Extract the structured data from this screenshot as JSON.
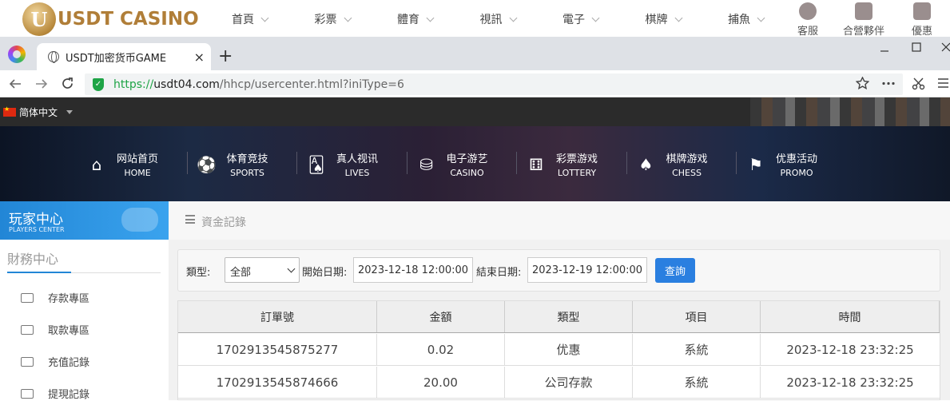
{
  "casino": {
    "logo_text": "USDT CASINO",
    "logo_letter": "U",
    "nav": [
      "首頁",
      "彩票",
      "體育",
      "視訊",
      "電子",
      "棋牌",
      "捕魚"
    ],
    "icons": [
      {
        "label": "客服",
        "icon": "chat-icon"
      },
      {
        "label": "合營夥伴",
        "icon": "partners-icon"
      },
      {
        "label": "優惠",
        "icon": "gift-icon"
      }
    ]
  },
  "browser": {
    "tab_title": "USDT加密货币GAME",
    "tab_close": "×",
    "new_tab": "+",
    "url_scheme": "https://",
    "url_host": "usdt04.com",
    "url_path": "/hhcp/usercenter.html?iniType=6",
    "shield_check": "✓"
  },
  "site": {
    "language": "简体中文",
    "mainnav": [
      {
        "zh": "网站首页",
        "en": "HOME",
        "icon": "home-icon"
      },
      {
        "zh": "体育竞技",
        "en": "SPORTS",
        "icon": "ball-icon"
      },
      {
        "zh": "真人视讯",
        "en": "LIVES",
        "icon": "cards-icon"
      },
      {
        "zh": "电子游艺",
        "en": "CASINO",
        "icon": "slot-icon"
      },
      {
        "zh": "彩票游戏",
        "en": "LOTTERY",
        "icon": "dice-icon"
      },
      {
        "zh": "棋牌游戏",
        "en": "CHESS",
        "icon": "spade-icon"
      },
      {
        "zh": "优惠活动",
        "en": "PROMO",
        "icon": "gift-icon"
      }
    ]
  },
  "sidebar": {
    "header_zh": "玩家中心",
    "header_en": "PLAYERS CENTER",
    "section": "財務中心",
    "items": [
      "存款專區",
      "取款專區",
      "充值記錄",
      "提現記錄"
    ]
  },
  "content": {
    "breadcrumb": "資金記錄",
    "filter": {
      "type_label": "類型:",
      "type_value": "全部",
      "start_label": "開始日期:",
      "start_value": "2023-12-18 12:00:00",
      "end_label": "結束日期:",
      "end_value": "2023-12-19 12:00:00",
      "query_button": "查詢"
    },
    "table": {
      "headers": [
        "訂單號",
        "金額",
        "類型",
        "項目",
        "時間"
      ],
      "rows": [
        [
          "1702913545875277",
          "0.02",
          "优惠",
          "系統",
          "2023-12-18 23:32:25"
        ],
        [
          "1702913545874666",
          "20.00",
          "公司存款",
          "系統",
          "2023-12-18 23:32:25"
        ]
      ]
    }
  }
}
